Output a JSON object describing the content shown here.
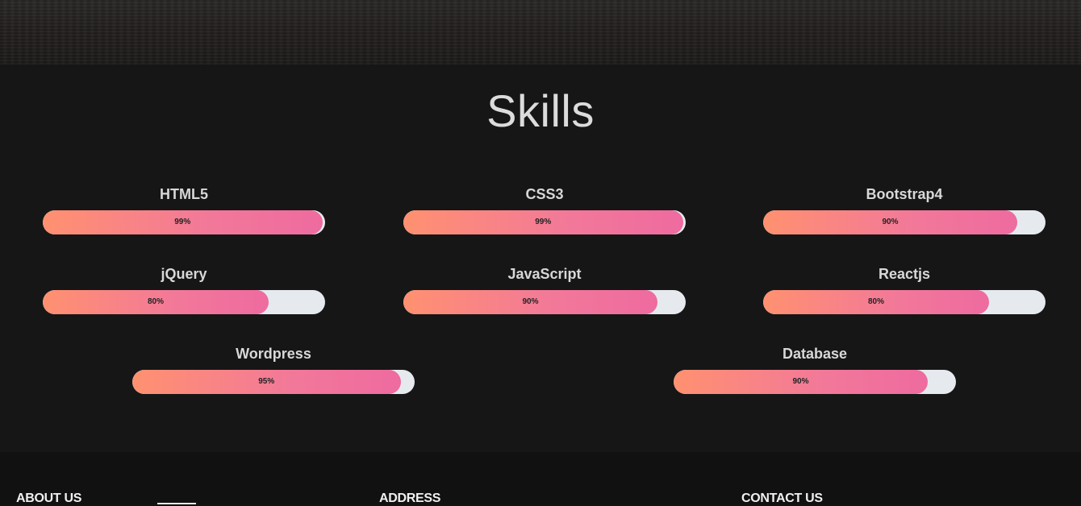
{
  "skills_section": {
    "title": "Skills",
    "skills": [
      {
        "name": "HTML5",
        "percent_label": "99%",
        "level": 99
      },
      {
        "name": "CSS3",
        "percent_label": "99%",
        "level": 99
      },
      {
        "name": "Bootstrap4",
        "percent_label": "90%",
        "level": 90
      },
      {
        "name": "jQuery",
        "percent_label": "80%",
        "level": 80
      },
      {
        "name": "JavaScript",
        "percent_label": "90%",
        "level": 90
      },
      {
        "name": "Reactjs",
        "percent_label": "80%",
        "level": 80
      },
      {
        "name": "Wordpress",
        "percent_label": "95%",
        "level": 95
      },
      {
        "name": "Database",
        "percent_label": "90%",
        "level": 90
      }
    ]
  },
  "footer": {
    "about_heading": "ABOUT US",
    "address_heading": "ADDRESS",
    "contact_heading": "CONTACT US"
  },
  "colors": {
    "fill_start": "#ff9170",
    "fill_end": "#ee6b9f",
    "track": "#e6eaee",
    "section_bg": "#161616"
  }
}
